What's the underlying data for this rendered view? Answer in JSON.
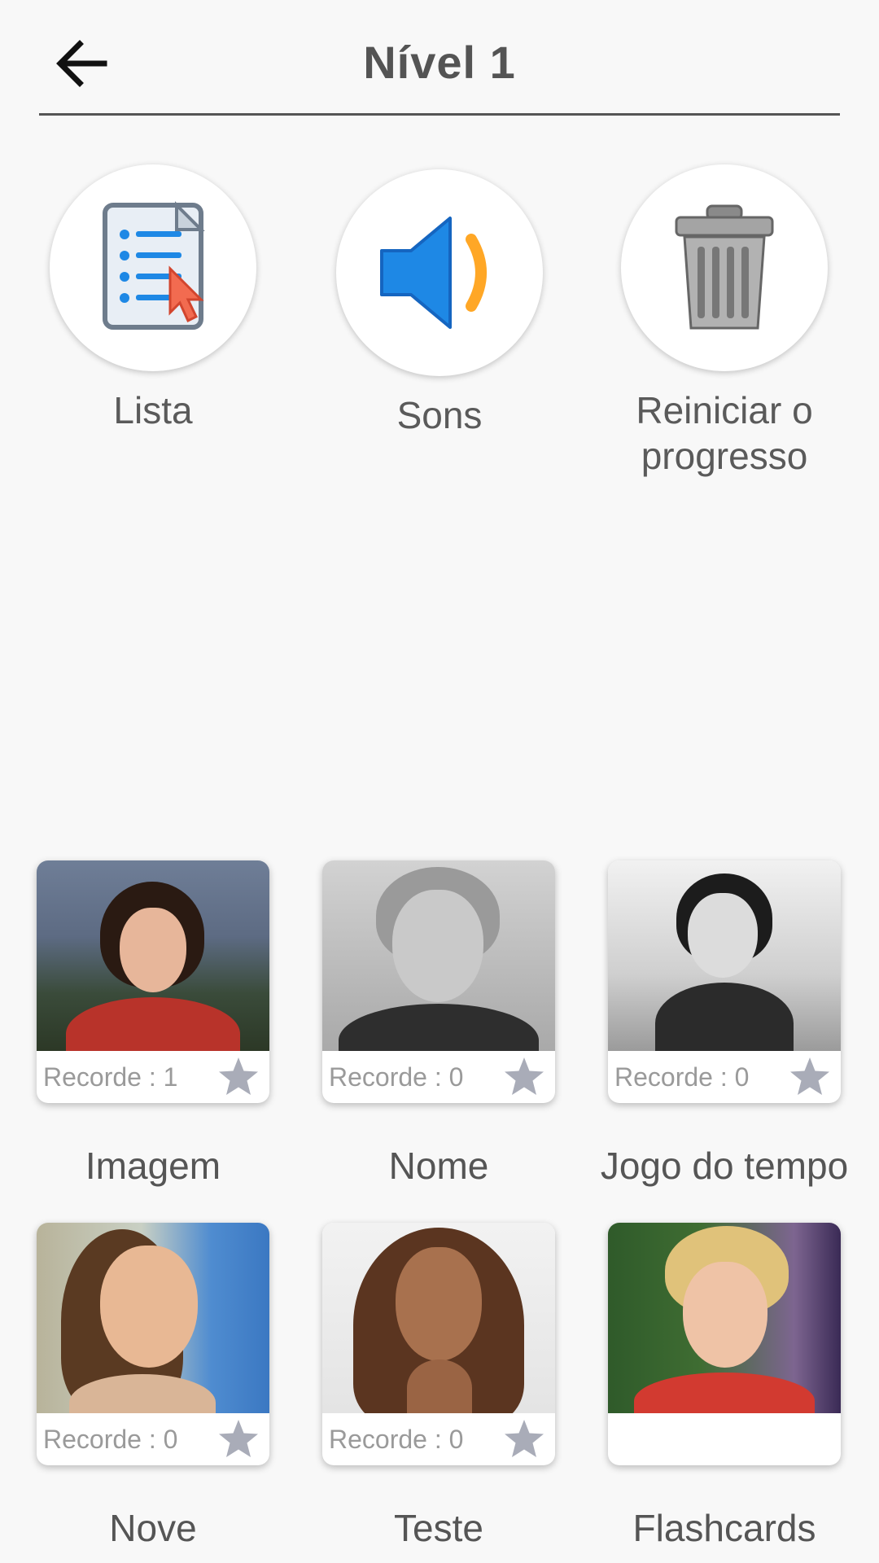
{
  "header": {
    "title": "Nível 1",
    "back_icon": "arrow-left-icon"
  },
  "actions": [
    {
      "label": "Lista",
      "icon": "list-document-icon"
    },
    {
      "label": "Sons",
      "icon": "speaker-icon"
    },
    {
      "label": "Reiniciar o progresso",
      "icon": "trash-can-icon"
    }
  ],
  "games": [
    {
      "label": "Imagem",
      "record": "Recorde : 1",
      "icon": "star-icon"
    },
    {
      "label": "Nome",
      "record": "Recorde : 0",
      "icon": "star-icon"
    },
    {
      "label": "Jogo do tempo",
      "record": "Recorde : 0",
      "icon": "star-icon"
    },
    {
      "label": "Nove",
      "record": "Recorde : 0",
      "icon": "star-icon"
    },
    {
      "label": "Teste",
      "record": "Recorde : 0",
      "icon": "star-icon"
    },
    {
      "label": "Flashcards",
      "record": "",
      "icon": ""
    }
  ],
  "colors": {
    "background": "#f8f8f8",
    "text": "#555555",
    "speaker_blue": "#1e88e5",
    "sound_wave_orange": "#ffa726",
    "star_gray": "#a9acb8"
  }
}
